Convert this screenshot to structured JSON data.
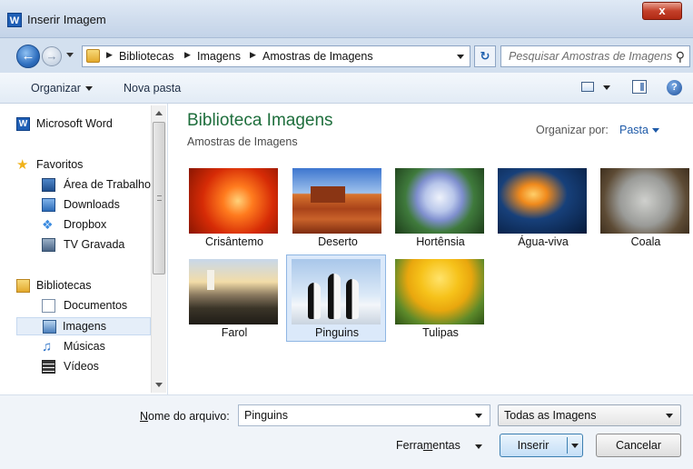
{
  "window": {
    "title": "Inserir Imagem",
    "app_icon": "W",
    "close_label": "x"
  },
  "address": {
    "crumbs": [
      "Bibliotecas",
      "Imagens",
      "Amostras de Imagens"
    ],
    "search_placeholder": "Pesquisar Amostras de Imagens"
  },
  "toolbar": {
    "organize": "Organizar",
    "new_folder": "Nova pasta",
    "help": "?"
  },
  "nav": {
    "top_item": "Microsoft Word",
    "favorites_header": "Favoritos",
    "favorites": [
      "Área de Trabalho",
      "Downloads",
      "Dropbox",
      "TV Gravada"
    ],
    "libraries_header": "Bibliotecas",
    "libraries": [
      "Documentos",
      "Imagens",
      "Músicas",
      "Vídeos"
    ],
    "selected": "Imagens"
  },
  "content": {
    "title": "Biblioteca Imagens",
    "subtitle": "Amostras de Imagens",
    "arrange_label": "Organizar por:",
    "arrange_value": "Pasta",
    "items": [
      {
        "caption": "Crisântemo"
      },
      {
        "caption": "Deserto"
      },
      {
        "caption": "Hortênsia"
      },
      {
        "caption": "Água-viva"
      },
      {
        "caption": "Coala"
      },
      {
        "caption": "Farol"
      },
      {
        "caption": "Pinguins"
      },
      {
        "caption": "Tulipas"
      }
    ],
    "selected_item": "Pinguins"
  },
  "footer": {
    "filename_label_prefix": "N",
    "filename_label_rest": "ome do arquivo:",
    "filename_value": "Pinguins",
    "filter_value": "Todas as Imagens",
    "tools_label_a": "Ferra",
    "tools_label_u": "m",
    "tools_label_b": "entas",
    "insert_label": "Inserir",
    "cancel_label": "Cancelar"
  }
}
